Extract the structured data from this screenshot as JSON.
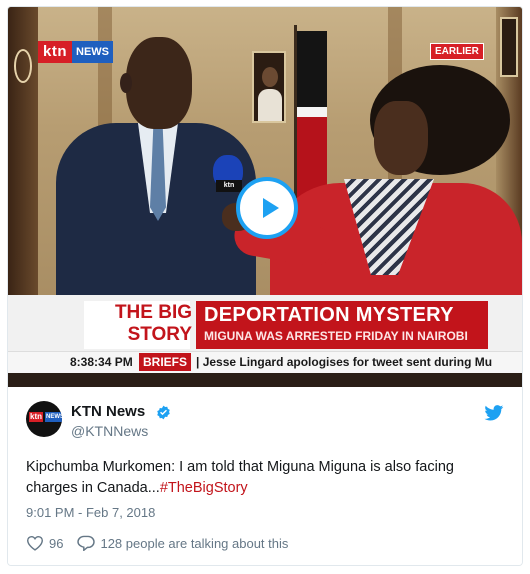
{
  "video": {
    "channel_logo_ktn": "ktn",
    "channel_logo_news": "NEWS",
    "earlier_badge": "EARLIER",
    "mic_label": "ktn",
    "lower_third": {
      "program_line1": "THE BIG",
      "program_line2": "STORY",
      "headline": "DEPORTATION MYSTERY",
      "subheadline": "MIGUNA WAS ARRESTED FRIDAY IN NAIROBI",
      "time": "8:38:34 PM",
      "briefs_label": "BRIEFS",
      "ticker": "| Jesse Lingard apologises for tweet sent during Mu"
    },
    "play_icon": "play-icon"
  },
  "tweet": {
    "avatar_ktn": "ktn",
    "avatar_news": "NEWS",
    "display_name": "KTN News",
    "handle": "@KTNNews",
    "text_main": "Kipchumba Murkomen: I am told that Miguna Miguna is also facing charges in Canada...",
    "hashtag": "#TheBigStory",
    "timestamp": "9:01 PM - Feb 7, 2018",
    "likes": "96",
    "replies_text": "128 people are talking about this"
  },
  "colors": {
    "twitter_blue": "#1da1f2",
    "ktn_red": "#c2141b",
    "text_primary": "#14171a",
    "text_secondary": "#657786"
  },
  "icons": {
    "verified": "verified-badge-icon",
    "bird": "twitter-bird-icon",
    "like": "heart-icon",
    "reply": "comment-bubble-icon"
  }
}
